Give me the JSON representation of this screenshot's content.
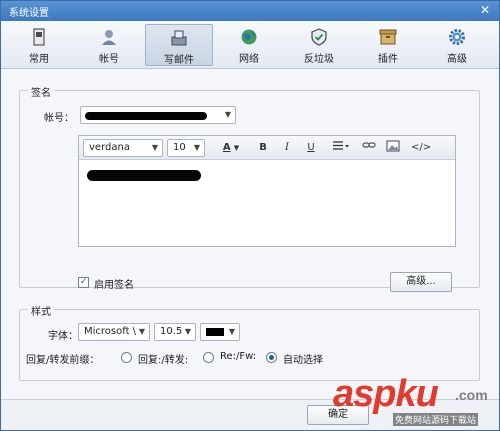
{
  "window": {
    "title": "系统设置"
  },
  "tabs": [
    {
      "label": "常用",
      "icon": "document-icon"
    },
    {
      "label": "帐号",
      "icon": "user-icon"
    },
    {
      "label": "写邮件",
      "icon": "compose-icon",
      "active": true
    },
    {
      "label": "网络",
      "icon": "globe-icon"
    },
    {
      "label": "反垃圾",
      "icon": "shield-icon"
    },
    {
      "label": "插件",
      "icon": "box-icon"
    },
    {
      "label": "高级",
      "icon": "gear-icon"
    }
  ],
  "signature": {
    "group_title": "签名",
    "account_label": "帐号：",
    "editor": {
      "font_family": "verdana",
      "font_size": "10",
      "font_color_label": "A",
      "bold": "B",
      "italic": "I",
      "underline": "U"
    },
    "enable_label": "启用签名",
    "enable_checked": true,
    "advanced_button": "高级..."
  },
  "style": {
    "group_title": "样式",
    "font_label": "字体：",
    "font_value": "Microsoft \\",
    "size_value": "10.5",
    "color_value": "#000000",
    "prefix_label": "回复/转发前缀：",
    "options": [
      {
        "label": "回复:/转发:",
        "selected": false
      },
      {
        "label": "Re:/Fw:",
        "selected": false
      },
      {
        "label": "自动选择",
        "selected": true
      }
    ]
  },
  "footer": {
    "ok_button": "确定"
  },
  "watermark": {
    "brand": "aspku",
    "suffix": ".com",
    "sub": "免费网站源码下载站"
  }
}
